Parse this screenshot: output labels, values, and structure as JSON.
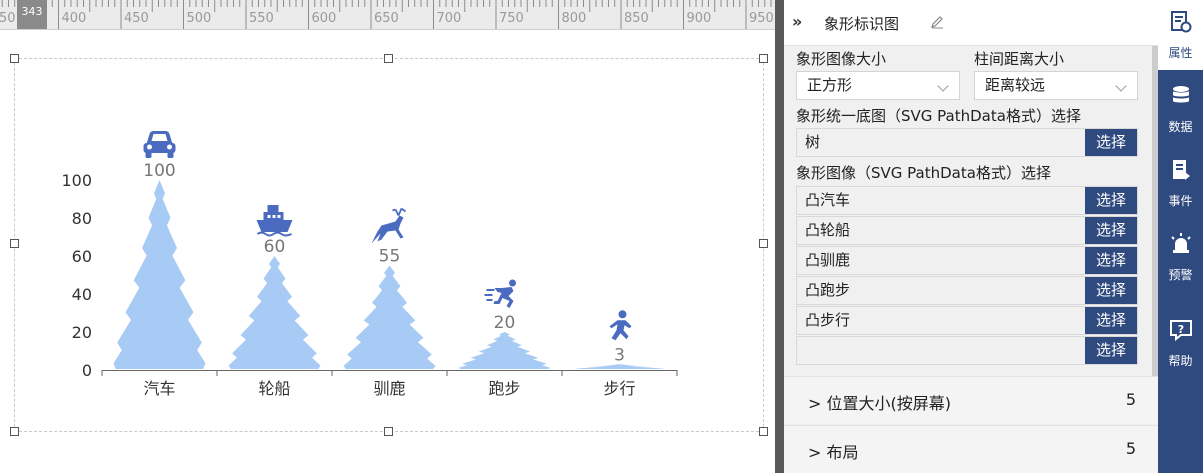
{
  "ruler": {
    "marker": "343",
    "ticks": [
      "50",
      "400",
      "450",
      "500",
      "550",
      "600",
      "650",
      "700",
      "750",
      "800",
      "850",
      "900",
      "950"
    ]
  },
  "chart_data": {
    "type": "bar",
    "subtype": "pictorial",
    "categories": [
      "汽车",
      "轮船",
      "驯鹿",
      "跑步",
      "步行"
    ],
    "values": [
      100,
      60,
      55,
      20,
      3
    ],
    "symbols": [
      "car-icon",
      "ship-icon",
      "deer-icon",
      "running-icon",
      "walking-icon"
    ],
    "ylim": [
      0,
      110
    ],
    "yticks": [
      "0",
      "20",
      "40",
      "60",
      "80",
      "100"
    ],
    "bar_color": "#a8cbf5",
    "icon_color": "#4a6bc0",
    "label_color": "#777777"
  },
  "panel": {
    "collapse_glyph": "»",
    "title": "象形标识图",
    "size_label": "象形图像大小",
    "size_value": "正方形",
    "gap_label": "柱间距离大小",
    "gap_value": "距离较远",
    "base_label": "象形统一底图（SVG PathData格式）选择",
    "base_value": "树",
    "select_label": "选择",
    "images_label": "象形图像（SVG PathData格式）选择",
    "images": [
      "凸汽车",
      "凸轮船",
      "凸驯鹿",
      "凸跑步",
      "凸步行",
      ""
    ],
    "sections": [
      {
        "label": "> 位置大小(按屏幕)",
        "count": "5"
      },
      {
        "label": "> 布局",
        "count": "5"
      }
    ]
  },
  "sidebar": {
    "items": [
      {
        "label": "属性",
        "icon": "properties-icon"
      },
      {
        "label": "数据",
        "icon": "database-icon"
      },
      {
        "label": "事件",
        "icon": "event-icon"
      },
      {
        "label": "预警",
        "icon": "alarm-icon"
      },
      {
        "label": "帮助",
        "icon": "help-icon"
      }
    ],
    "active_color": "#2f4a7f"
  }
}
